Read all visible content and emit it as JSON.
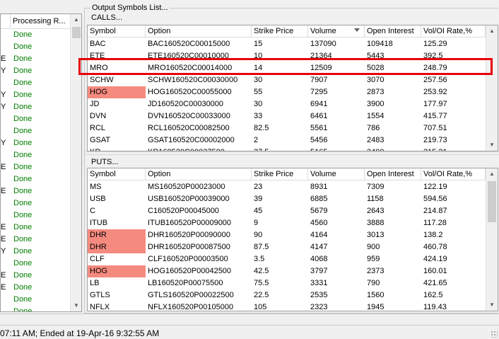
{
  "left_panel": {
    "header": "Processing R...",
    "rows": [
      {
        "prefix": "",
        "status": "Done"
      },
      {
        "prefix": "",
        "status": "Done"
      },
      {
        "prefix": "E",
        "status": "Done"
      },
      {
        "prefix": "Y",
        "status": "Done"
      },
      {
        "prefix": "",
        "status": "Done"
      },
      {
        "prefix": "Y",
        "status": "Done"
      },
      {
        "prefix": "Y",
        "status": "Done"
      },
      {
        "prefix": "",
        "status": "Done"
      },
      {
        "prefix": "",
        "status": "Done"
      },
      {
        "prefix": "Y",
        "status": "Done"
      },
      {
        "prefix": "",
        "status": "Done"
      },
      {
        "prefix": "E",
        "status": "Done"
      },
      {
        "prefix": "",
        "status": "Done"
      },
      {
        "prefix": "E",
        "status": "Done"
      },
      {
        "prefix": "",
        "status": "Done"
      },
      {
        "prefix": "",
        "status": "Done"
      },
      {
        "prefix": "E",
        "status": "Done"
      },
      {
        "prefix": "E",
        "status": "Done"
      },
      {
        "prefix": "Y",
        "status": "Done"
      },
      {
        "prefix": "",
        "status": "Done"
      },
      {
        "prefix": "E",
        "status": "Done"
      },
      {
        "prefix": "E",
        "status": "Done"
      },
      {
        "prefix": "",
        "status": "Done"
      },
      {
        "prefix": "",
        "status": "Done"
      }
    ]
  },
  "output": {
    "title": "Output Symbols List...",
    "calls": {
      "label": "CALLS...",
      "columns": [
        "Symbol",
        "Option",
        "Strike Price",
        "Volume",
        "Open Interest",
        "Vol/OI Rate,%"
      ],
      "rows": [
        {
          "symbol": "BAC",
          "option": "BAC160520C00015000",
          "strike": "15",
          "volume": "137090",
          "oi": "109418",
          "rate": "125.29",
          "highlight": false
        },
        {
          "symbol": "ETE",
          "option": "ETE160520C00010000",
          "strike": "10",
          "volume": "21364",
          "oi": "5443",
          "rate": "392.5",
          "highlight": false
        },
        {
          "symbol": "MRO",
          "option": "MRO160520C00014000",
          "strike": "14",
          "volume": "12509",
          "oi": "5028",
          "rate": "248.79",
          "highlight": false
        },
        {
          "symbol": "SCHW",
          "option": "SCHW160520C00030000",
          "strike": "30",
          "volume": "7907",
          "oi": "3070",
          "rate": "257.56",
          "highlight": false
        },
        {
          "symbol": "HOG",
          "option": "HOG160520C00055000",
          "strike": "55",
          "volume": "7295",
          "oi": "2873",
          "rate": "253.92",
          "highlight": true
        },
        {
          "symbol": "JD",
          "option": "JD160520C00030000",
          "strike": "30",
          "volume": "6941",
          "oi": "3900",
          "rate": "177.97",
          "highlight": false
        },
        {
          "symbol": "DVN",
          "option": "DVN160520C00033000",
          "strike": "33",
          "volume": "6461",
          "oi": "1554",
          "rate": "415.77",
          "highlight": false
        },
        {
          "symbol": "RCL",
          "option": "RCL160520C00082500",
          "strike": "82.5",
          "volume": "5561",
          "oi": "786",
          "rate": "707.51",
          "highlight": false
        },
        {
          "symbol": "GSAT",
          "option": "GSAT160520C00002000",
          "strike": "2",
          "volume": "5456",
          "oi": "2483",
          "rate": "219.73",
          "highlight": false
        },
        {
          "symbol": "KR",
          "option": "KR160520C00037500",
          "strike": "37.5",
          "volume": "5165",
          "oi": "2400",
          "rate": "215.21",
          "highlight": false
        }
      ]
    },
    "puts": {
      "label": "PUTS...",
      "columns": [
        "Symbol",
        "Option",
        "Strike Price",
        "Volume",
        "Open Interest",
        "Vol/OI Rate,%"
      ],
      "rows": [
        {
          "symbol": "MS",
          "option": "MS160520P00023000",
          "strike": "23",
          "volume": "8931",
          "oi": "7309",
          "rate": "122.19",
          "highlight": false
        },
        {
          "symbol": "USB",
          "option": "USB160520P00039000",
          "strike": "39",
          "volume": "6885",
          "oi": "1158",
          "rate": "594.56",
          "highlight": false
        },
        {
          "symbol": "C",
          "option": "C160520P00045000",
          "strike": "45",
          "volume": "5679",
          "oi": "2643",
          "rate": "214.87",
          "highlight": false
        },
        {
          "symbol": "ITUB",
          "option": "ITUB160520P00009000",
          "strike": "9",
          "volume": "4560",
          "oi": "3888",
          "rate": "117.28",
          "highlight": false
        },
        {
          "symbol": "DHR",
          "option": "DHR160520P00090000",
          "strike": "90",
          "volume": "4164",
          "oi": "3013",
          "rate": "138.2",
          "highlight": true
        },
        {
          "symbol": "DHR",
          "option": "DHR160520P00087500",
          "strike": "87.5",
          "volume": "4147",
          "oi": "900",
          "rate": "460.78",
          "highlight": true
        },
        {
          "symbol": "CLF",
          "option": "CLF160520P00003500",
          "strike": "3.5",
          "volume": "4068",
          "oi": "959",
          "rate": "424.19",
          "highlight": false
        },
        {
          "symbol": "HOG",
          "option": "HOG160520P00042500",
          "strike": "42.5",
          "volume": "3797",
          "oi": "2373",
          "rate": "160.01",
          "highlight": true
        },
        {
          "symbol": "LB",
          "option": "LB160520P00075500",
          "strike": "75.5",
          "volume": "3331",
          "oi": "790",
          "rate": "421.65",
          "highlight": false
        },
        {
          "symbol": "GTLS",
          "option": "GTLS160520P00022500",
          "strike": "22.5",
          "volume": "2535",
          "oi": "1560",
          "rate": "162.5",
          "highlight": false
        },
        {
          "symbol": "NFLX",
          "option": "NFLX160520P00105000",
          "strike": "105",
          "volume": "2323",
          "oi": "1945",
          "rate": "119.43",
          "highlight": false
        }
      ]
    }
  },
  "status_bar": {
    "text": "07:11 AM; Ended at 19-Apr-16 9:32:55 AM"
  },
  "colors": {
    "done": "#008000",
    "highlight_cell": "#f58a7f",
    "annotation_box": "#e8000b"
  }
}
